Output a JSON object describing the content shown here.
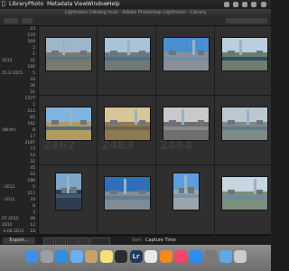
{
  "menubar": {
    "items": [
      "Library",
      "Photo",
      "Metadata",
      "View",
      "Window",
      "Help"
    ]
  },
  "window": {
    "title": "Lightroom Catalog.lrcat - Adobe Photoshop Lightroom - Library"
  },
  "left_panel": {
    "rows": [
      {
        "label": "",
        "count": "23"
      },
      {
        "label": "",
        "count": "133"
      },
      {
        "label": "",
        "count": "169"
      },
      {
        "label": "",
        "count": "2"
      },
      {
        "label": "",
        "count": "1"
      },
      {
        "label": "2015",
        "count": "31"
      },
      {
        "label": "",
        "count": "166"
      },
      {
        "label": "25.2.2015",
        "count": "5"
      },
      {
        "label": "",
        "count": "33"
      },
      {
        "label": "",
        "count": "36"
      },
      {
        "label": "",
        "count": "31"
      },
      {
        "label": "",
        "count": "1377"
      },
      {
        "label": "",
        "count": "1"
      },
      {
        "label": "",
        "count": "212"
      },
      {
        "label": "",
        "count": "65"
      },
      {
        "label": "",
        "count": "162"
      },
      {
        "label": "(Wirth)",
        "count": "8"
      },
      {
        "label": "",
        "count": "17"
      },
      {
        "label": "",
        "count": "2187"
      },
      {
        "label": "",
        "count": "73"
      },
      {
        "label": "",
        "count": "14"
      },
      {
        "label": "",
        "count": "32"
      },
      {
        "label": "",
        "count": "45"
      },
      {
        "label": "",
        "count": "33"
      },
      {
        "label": "",
        "count": "186"
      },
      {
        "label": "- 2012",
        "count": "5"
      },
      {
        "label": "",
        "count": "211"
      },
      {
        "label": "- 2012",
        "count": "33"
      },
      {
        "label": "",
        "count": "8"
      },
      {
        "label": "",
        "count": "3"
      },
      {
        "label": "07.2015",
        "count": "48"
      },
      {
        "label": "2012",
        "count": "12"
      },
      {
        "label": "-3.08.2012",
        "count": "18"
      },
      {
        "label": "",
        "count": ""
      }
    ]
  },
  "grid": {
    "cell_numbers": [
      "",
      "",
      "",
      "",
      "2462",
      "2463",
      "2464",
      "",
      "",
      "",
      "",
      ""
    ],
    "thumbs": [
      {
        "sky": "#9fb6c9",
        "land": "#7c7a6c",
        "river": "#5f7484"
      },
      {
        "sky": "#a9c3d8",
        "land": "#6e7b74",
        "river": "#4f6f88"
      },
      {
        "sky": "#4a8fd0",
        "land": "#8a8f96",
        "river": "#6c8faa"
      },
      {
        "sky": "#b9cfdf",
        "land": "#6c7f6a",
        "river": "#2f4f6a"
      },
      {
        "sky": "#7fb4e0",
        "land": "#b49a62",
        "river": "#566e7a"
      },
      {
        "sky": "#d8c69a",
        "land": "#8c7a52",
        "river": "#706548"
      },
      {
        "sky": "#c9c9c9",
        "land": "#6e6e6e",
        "river": "#8a8a8a"
      },
      {
        "sky": "#bcc8d0",
        "land": "#7e8a86",
        "river": "#5f7a8c"
      },
      {
        "sky": "#7aa6c8",
        "land": "#2f3d4e",
        "river": "#405a70"
      },
      {
        "sky": "#2f6fb7",
        "land": "#7f8c96",
        "river": "#5f7e96"
      },
      {
        "sky": "#5b9ee0",
        "land": "#9aa4ad",
        "river": "#7e93a4"
      },
      {
        "sky": "#c8d6e2",
        "land": "#7b8f7a",
        "river": "#6b8aa0"
      }
    ]
  },
  "bottom_toolbar": {
    "export_label": "Export...",
    "sort_label": "Sort:",
    "sort_value": "Capture Time"
  },
  "dock": {
    "apps": [
      {
        "name": "finder-icon",
        "color": "#3f8fe6"
      },
      {
        "name": "launchpad-icon",
        "color": "#9aa0aa"
      },
      {
        "name": "safari-icon",
        "color": "#2f8fe0"
      },
      {
        "name": "mail-icon",
        "color": "#6ab0f0"
      },
      {
        "name": "contacts-icon",
        "color": "#c9a26a"
      },
      {
        "name": "notes-icon",
        "color": "#f5e07a"
      },
      {
        "name": "terminal-icon",
        "color": "#2b2b2b"
      },
      {
        "name": "lightroom-icon",
        "color": "#213a5c",
        "text": "Lr"
      },
      {
        "name": "photos-icon",
        "color": "#e9e9e9"
      },
      {
        "name": "vlc-icon",
        "color": "#f28a1e"
      },
      {
        "name": "music-icon",
        "color": "#f0476a"
      },
      {
        "name": "app-store-icon",
        "color": "#2a8df0"
      },
      {
        "name": "system-preferences-icon",
        "color": "#7a7a7a"
      },
      {
        "name": "folder-icon",
        "color": "#5fa8e8"
      },
      {
        "name": "trash-icon",
        "color": "#c9ccd0"
      }
    ]
  }
}
